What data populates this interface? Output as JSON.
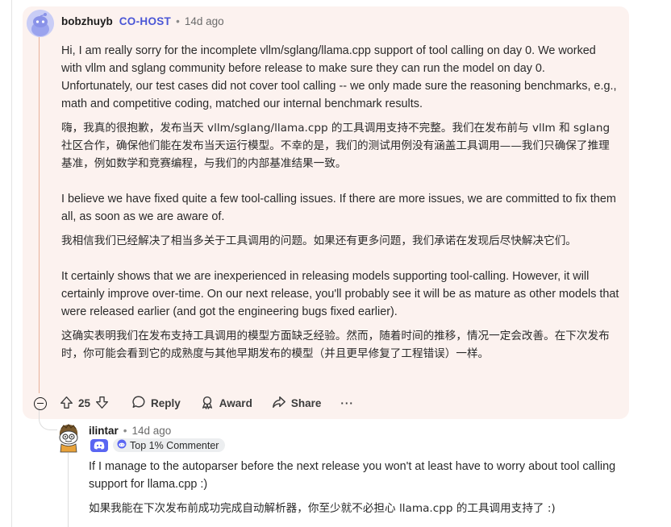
{
  "main_comment": {
    "author": "bobzhuyb",
    "role_badge": "CO-HOST",
    "separator": "•",
    "age": "14d ago",
    "paragraphs": [
      "Hi, I am really sorry for the incomplete vllm/sglang/llama.cpp support of tool calling on day 0. We worked with vllm and sglang community before release to make sure they can run the model on day 0. Unfortunately, our test cases did not cover tool calling -- we only made sure the reasoning benchmarks, e.g., math and competitive coding, matched our internal benchmark results.",
      "嗨，我真的很抱歉，发布当天 vllm/sglang/llama.cpp 的工具调用支持不完整。我们在发布前与 vllm 和 sglang 社区合作，确保他们能在发布当天运行模型。不幸的是，我们的测试用例没有涵盖工具调用——我们只确保了推理基准，例如数学和竞赛编程，与我们的内部基准结果一致。",
      "I believe we have fixed quite a few tool-calling issues. If there are more issues, we are committed to fix them all, as soon as we are aware of.",
      "我相信我们已经解决了相当多关于工具调用的问题。如果还有更多问题，我们承诺在发现后尽快解决它们。",
      "It certainly shows that we are inexperienced in releasing models supporting tool-calling. However, it will certainly improve over-time. On our next release, you'll probably see it will be as mature as other models that were released earlier (and got the engineering bugs fixed earlier).",
      "这确实表明我们在发布支持工具调用的模型方面缺乏经验。然而，随着时间的推移，情况一定会改善。在下次发布时，你可能会看到它的成熟度与其他早期发布的模型（并且更早修复了工程错误）一样。"
    ],
    "actions": {
      "score": "25",
      "reply": "Reply",
      "award": "Award",
      "share": "Share",
      "more": "···"
    }
  },
  "reply_comment": {
    "author": "ilintar",
    "separator": "•",
    "age": "14d ago",
    "badge": "Top 1% Commenter",
    "paragraphs": [
      "If I manage to the autoparser before the next release you won't at least have to worry about tool calling support for llama.cpp :)",
      "如果我能在下次发布前成功完成自动解析器，你至少就不必担心 llama.cpp 的工具调用支持了 :)"
    ]
  },
  "colors": {
    "highlight_bg": "#fcf2ef",
    "cohost": "#4a56d6",
    "thread_line": "#e8b19a",
    "discord": "#5a66f2"
  },
  "icons": [
    "collapse-icon",
    "upvote-icon",
    "downvote-icon",
    "reply-icon",
    "award-icon",
    "share-icon",
    "more-icon",
    "discord-icon",
    "snoo-badge-icon"
  ]
}
